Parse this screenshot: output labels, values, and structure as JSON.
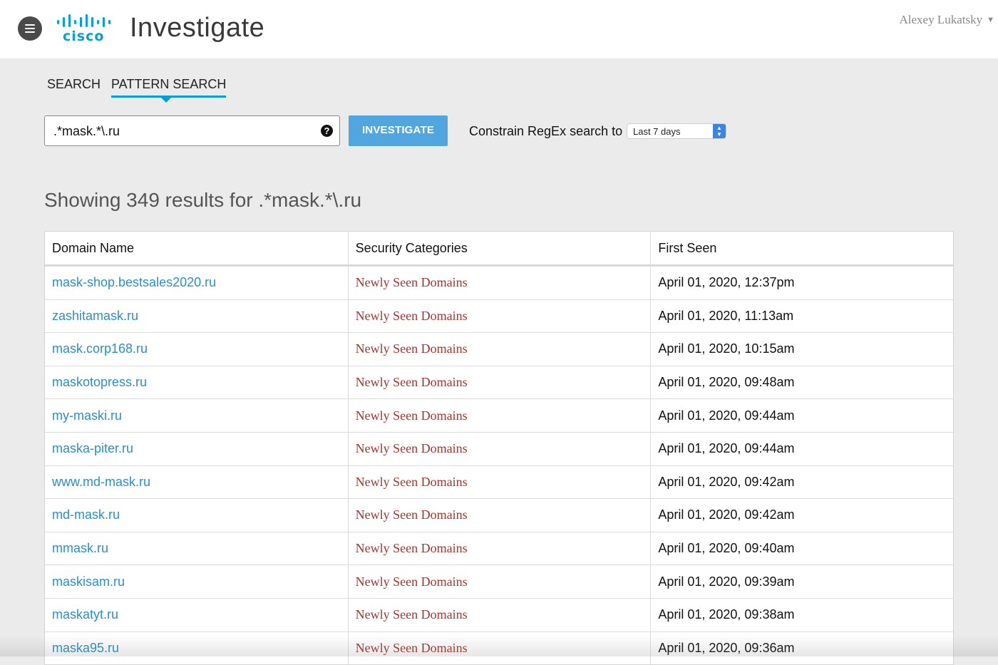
{
  "header": {
    "logo_text": "cisco",
    "app_title": "Investigate",
    "user_name": "Alexey Lukatsky",
    "brand_color": "#049fd9"
  },
  "tabs": [
    {
      "label": "SEARCH",
      "active": false
    },
    {
      "label": "PATTERN SEARCH",
      "active": true
    }
  ],
  "search": {
    "value": ".*mask.*\\.ru",
    "help_icon": "question-circle-icon",
    "button_label": "INVESTIGATE",
    "constrain_label": "Constrain RegEx search to",
    "range_selected": "Last 7 days"
  },
  "results": {
    "heading": "Showing 349 results for .*mask.*\\.ru",
    "columns": [
      "Domain Name",
      "Security Categories",
      "First Seen"
    ],
    "rows": [
      {
        "domain": "mask-shop.bestsales2020.ru",
        "category": "Newly Seen Domains",
        "first_seen": "April 01, 2020, 12:37pm"
      },
      {
        "domain": "zashitamask.ru",
        "category": "Newly Seen Domains",
        "first_seen": "April 01, 2020, 11:13am"
      },
      {
        "domain": "mask.corp168.ru",
        "category": "Newly Seen Domains",
        "first_seen": "April 01, 2020, 10:15am"
      },
      {
        "domain": "maskotopress.ru",
        "category": "Newly Seen Domains",
        "first_seen": "April 01, 2020, 09:48am"
      },
      {
        "domain": "my-maski.ru",
        "category": "Newly Seen Domains",
        "first_seen": "April 01, 2020, 09:44am"
      },
      {
        "domain": "maska-piter.ru",
        "category": "Newly Seen Domains",
        "first_seen": "April 01, 2020, 09:44am"
      },
      {
        "domain": "www.md-mask.ru",
        "category": "Newly Seen Domains",
        "first_seen": "April 01, 2020, 09:42am"
      },
      {
        "domain": "md-mask.ru",
        "category": "Newly Seen Domains",
        "first_seen": "April 01, 2020, 09:42am"
      },
      {
        "domain": "mmask.ru",
        "category": "Newly Seen Domains",
        "first_seen": "April 01, 2020, 09:40am"
      },
      {
        "domain": "maskisam.ru",
        "category": "Newly Seen Domains",
        "first_seen": "April 01, 2020, 09:39am"
      },
      {
        "domain": "maskatyt.ru",
        "category": "Newly Seen Domains",
        "first_seen": "April 01, 2020, 09:38am"
      },
      {
        "domain": "maska95.ru",
        "category": "Newly Seen Domains",
        "first_seen": "April 01, 2020, 09:36am"
      }
    ]
  }
}
